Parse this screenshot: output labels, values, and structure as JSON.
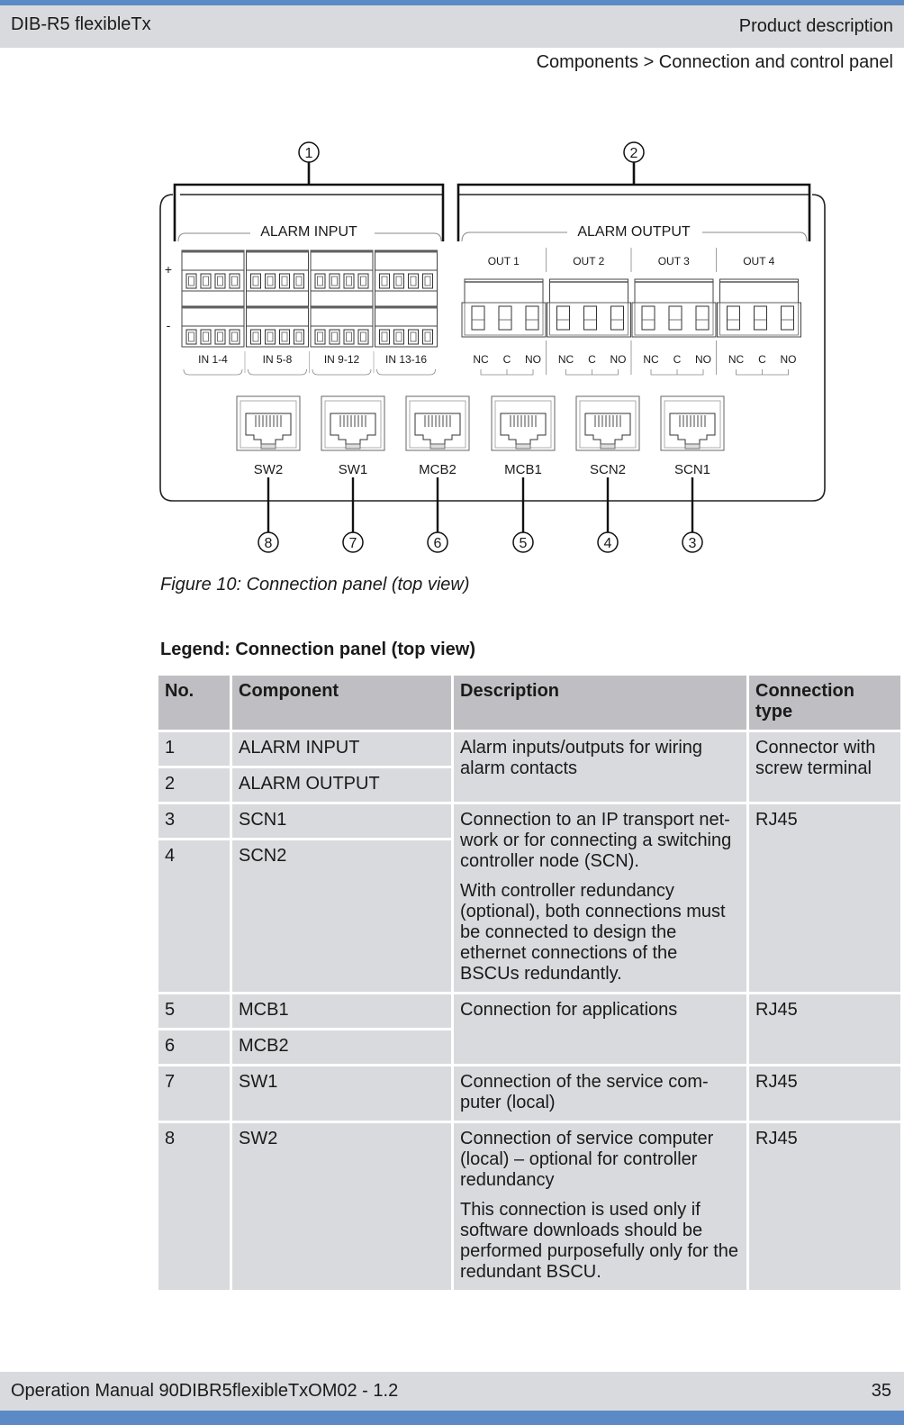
{
  "header": {
    "doc_title": "DIB-R5 flexibleTx",
    "section": "Product description",
    "breadcrumb": "Components > Connection and control panel"
  },
  "figure": {
    "caption": "Figure 10: Connection panel (top view)",
    "alarm_input": {
      "label": "ALARM INPUT",
      "plus_label": "+",
      "minus_label": "-",
      "blocks": [
        "IN 1-4",
        "IN 5-8",
        "IN 9-12",
        "IN 13-16"
      ]
    },
    "alarm_output": {
      "label": "ALARM OUTPUT",
      "blocks": [
        "OUT 1",
        "OUT 2",
        "OUT 3",
        "OUT 4"
      ],
      "contacts": [
        "NC",
        "C",
        "NO"
      ]
    },
    "rj45_ports": [
      "SW2",
      "SW1",
      "MCB2",
      "MCB1",
      "SCN2",
      "SCN1"
    ],
    "callouts": {
      "top": [
        "1",
        "2"
      ],
      "bottom": [
        "8",
        "7",
        "6",
        "5",
        "4",
        "3"
      ]
    }
  },
  "legend": {
    "title": "Legend: Connection panel (top view)",
    "columns": [
      "No.",
      "Component",
      "Description",
      "Connection type"
    ],
    "rows": [
      {
        "no": "1",
        "component": "ALARM INPUT"
      },
      {
        "no": "2",
        "component": "ALARM OUTPUT"
      },
      {
        "no": "3",
        "component": "SCN1"
      },
      {
        "no": "4",
        "component": "SCN2"
      },
      {
        "no": "5",
        "component": "MCB1"
      },
      {
        "no": "6",
        "component": "MCB2"
      },
      {
        "no": "7",
        "component": "SW1"
      },
      {
        "no": "8",
        "component": "SW2"
      }
    ],
    "groups": [
      {
        "description": [
          "Alarm inputs/outputs for wiring alarm contacts"
        ],
        "connection_type": "Connector with screw terminal"
      },
      {
        "description": [
          "Connection to an IP transport net-work or for connecting a switching controller node (SCN).",
          "With controller redundancy (optional), both connections must be connected to design the ethernet connections of the BSCUs redundantly."
        ],
        "connection_type": "RJ45"
      },
      {
        "description": [
          "Connection for applications"
        ],
        "connection_type": "RJ45"
      },
      {
        "description": [
          "Connection of the service com-puter (local)"
        ],
        "connection_type": "RJ45"
      },
      {
        "description": [
          "Connection of service computer (local) – optional for controller redundancy",
          "This connection is used only if software downloads should be performed purposefully only for the redundant BSCU."
        ],
        "connection_type": "RJ45"
      }
    ]
  },
  "footer": {
    "manual": "Operation Manual 90DIBR5flexibleTxOM02 - 1.2",
    "page": "35"
  },
  "colors": {
    "accent_stripe": "#5b8ac6",
    "header_bg": "#d9dadd",
    "table_header_bg": "#bfbfc3",
    "table_cell_bg": "#d9dadd"
  }
}
